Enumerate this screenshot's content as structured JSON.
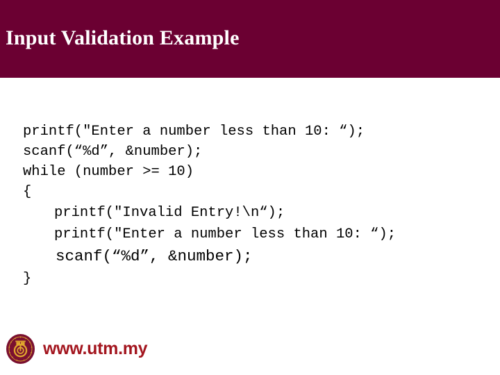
{
  "slide": {
    "title": "Input Validation Example",
    "header_color": "#6B0032",
    "background_color": "#FFFFFF",
    "title_color": "#FFFFFF"
  },
  "code": {
    "language": "c",
    "text_color": "#000000",
    "lines": [
      {
        "indent": 0,
        "text": "printf(\"Enter a number less than 10: “);"
      },
      {
        "indent": 0,
        "text": "scanf(“%d”, &number);"
      },
      {
        "indent": 0,
        "text": "while (number >= 10)"
      },
      {
        "indent": 0,
        "text": "{"
      },
      {
        "indent": 1,
        "text": "printf(\"Invalid Entry!\\n“);"
      },
      {
        "indent": 1,
        "text": "printf(\"Enter a number less than 10: “);"
      },
      {
        "indent": 1,
        "text": "scanf(“%d”, &number);"
      },
      {
        "indent": 0,
        "text": "}"
      }
    ]
  },
  "footer": {
    "url": "www.utm.my",
    "url_color": "#A3161F",
    "logo_name": "utm-seal-logo",
    "logo_colors": {
      "seal": "#7A1030",
      "emblem": "#E0A62E",
      "ring_text": "#E0A62E"
    }
  }
}
